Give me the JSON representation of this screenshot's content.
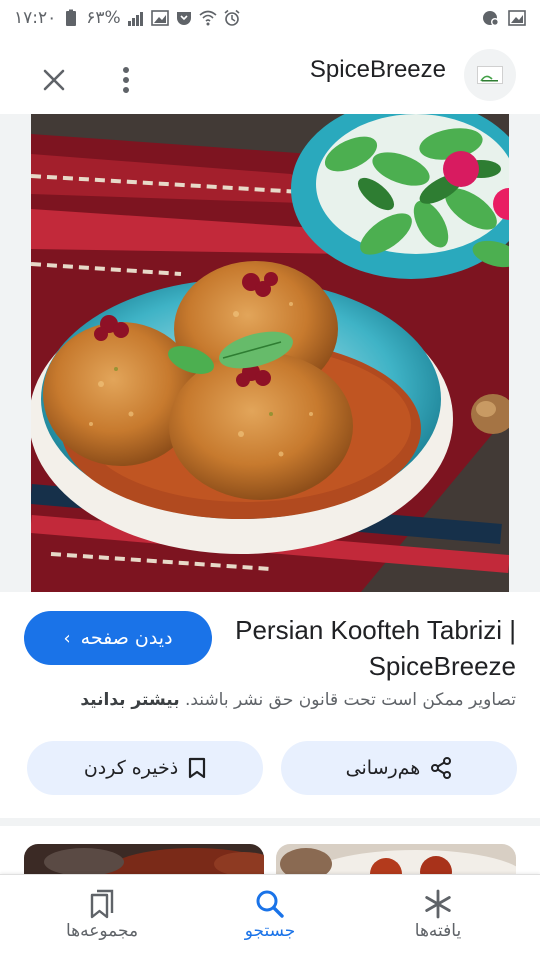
{
  "status_bar": {
    "time": "۱۷:۲۰",
    "battery": "۶۳%"
  },
  "header": {
    "site_name": "SpiceBreeze",
    "close_icon": "close-icon",
    "more_icon": "more-vert-icon"
  },
  "result": {
    "title": "Persian Koofteh Tabrizi | SpiceBreeze",
    "visit_label": "دیدن صفحه",
    "copyright_text": "تصاویر ممکن است تحت قانون حق نشر باشند.",
    "learn_more": "بیشتر بدانید",
    "share_label": "هم‌رسانی",
    "save_label": "ذخیره کردن"
  },
  "bottom_nav": {
    "items": [
      {
        "label": "مجموعه‌ها",
        "icon": "bookmarks-icon",
        "active": false
      },
      {
        "label": "جستجو",
        "icon": "search-icon",
        "active": true
      },
      {
        "label": "یافته‌ها",
        "icon": "asterisk-icon",
        "active": false
      }
    ]
  },
  "colors": {
    "accent": "#1a73e8",
    "pill_bg": "#e8f0fe"
  }
}
